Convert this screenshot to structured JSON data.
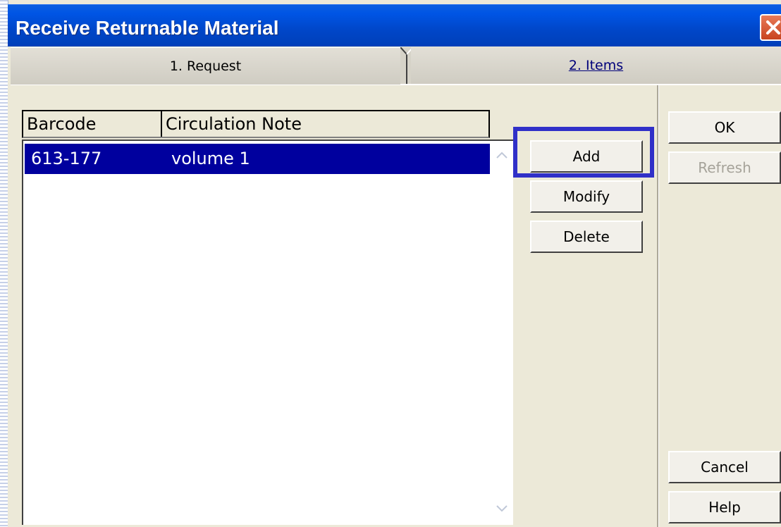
{
  "window": {
    "title": "Receive Returnable Material"
  },
  "tabs": [
    {
      "label": "1. Request",
      "active": true
    },
    {
      "label": "2. Items",
      "active": false
    }
  ],
  "grid": {
    "columns": [
      "Barcode",
      "Circulation Note"
    ],
    "rows": [
      {
        "barcode": "613-177",
        "note": "volume 1",
        "selected": true
      }
    ]
  },
  "actions": {
    "add": "Add",
    "modify": "Modify",
    "delete": "Delete"
  },
  "dialog_buttons": {
    "ok": "OK",
    "refresh": "Refresh",
    "cancel": "Cancel",
    "help": "Help"
  },
  "colors": {
    "titlebar": "#0055e5",
    "selection": "#00009e",
    "highlight": "#3030c8"
  }
}
